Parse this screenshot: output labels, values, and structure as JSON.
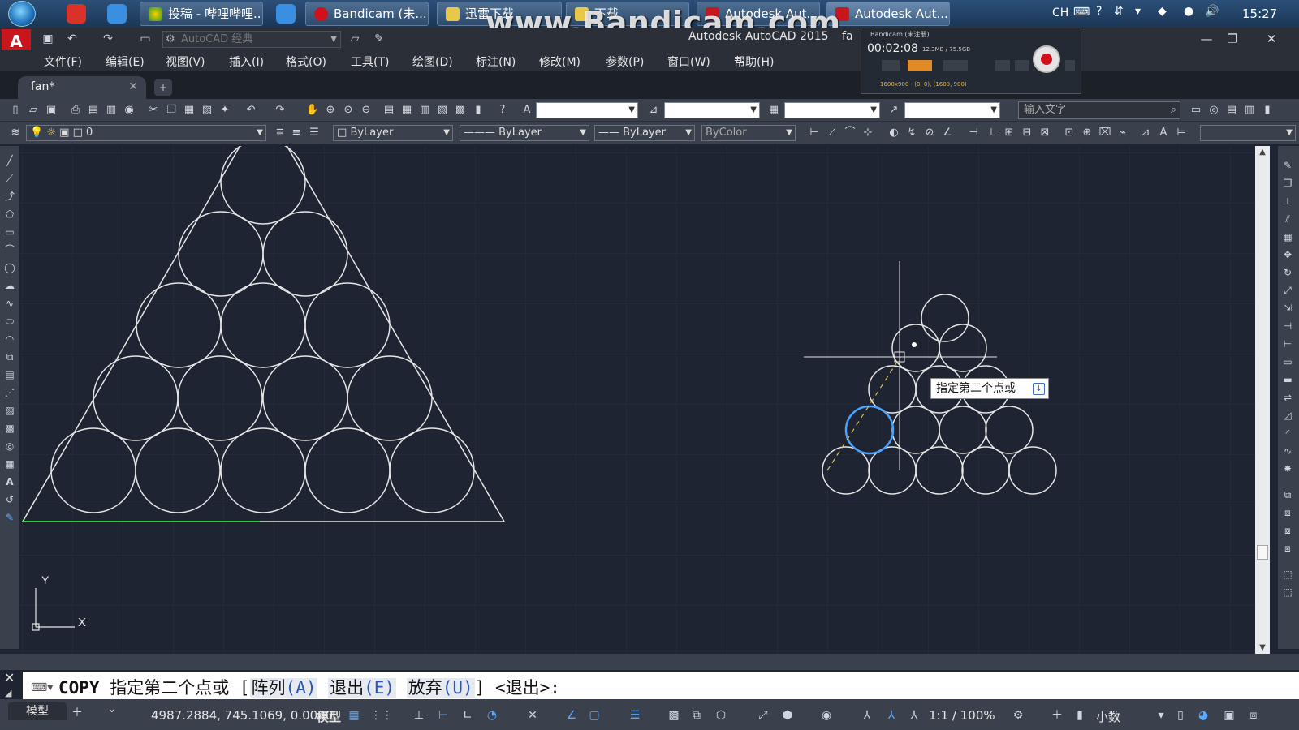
{
  "taskbar": {
    "tasks": [
      {
        "label": "投稿 - 哔哩哔哩...",
        "icon": "chrome-icon"
      },
      {
        "label": "Bandicam (未...",
        "icon": "bandicam-icon"
      },
      {
        "label": "迅雷下载",
        "icon": "folder-icon"
      },
      {
        "label": "下载",
        "icon": "folder-icon"
      },
      {
        "label": "Autodesk Aut...",
        "icon": "autocad-icon"
      },
      {
        "label": "Autodesk Aut...",
        "icon": "autocad-icon"
      }
    ],
    "tray_lang": "CH",
    "clock": "15:27"
  },
  "watermark": "www.Bandicam.com",
  "titlebar": {
    "workspace": "AutoCAD 经典",
    "app_title": "Autodesk AutoCAD 2015",
    "file_fragment": "fa"
  },
  "menu": [
    "文件(F)",
    "编辑(E)",
    "视图(V)",
    "插入(I)",
    "格式(O)",
    "工具(T)",
    "绘图(D)",
    "标注(N)",
    "修改(M)",
    "参数(P)",
    "窗口(W)",
    "帮助(H)"
  ],
  "file_tab": {
    "name": "fan*",
    "close": "✕",
    "new": "+"
  },
  "search": {
    "placeholder": "输入文字"
  },
  "properties": {
    "layer": "0",
    "color": "ByLayer",
    "linetype": "ByLayer",
    "lineweight": "ByLayer",
    "plotstyle": "ByColor"
  },
  "bandicam": {
    "title": "Bandicam (未注册)",
    "time": "00:02:08",
    "size": "12.3MB / 75.5GB",
    "resolution": "1600x900 - (0, 0), (1600, 900)"
  },
  "ucs": {
    "x": "X",
    "y": "Y"
  },
  "tooltip": {
    "text": "指定第二个点或"
  },
  "command": {
    "name": "COPY",
    "prompt": "指定第二个点或",
    "open": "[",
    "opt1": "阵列",
    "opt1_key": "(A)",
    "opt2": "退出",
    "opt2_key": "(E)",
    "opt3": "放弃",
    "opt3_key": "(U)",
    "close": "]",
    "default": "<退出>:"
  },
  "status": {
    "model_tab": "模型",
    "coords": "4987.2884, 745.1069, 0.0000",
    "space": "模型",
    "scale": "1:1 / 100%",
    "units": "小数"
  },
  "colors": {
    "canvas": "#1e2431",
    "circle": "#e8e8e8",
    "highlight": "#4aa3ff",
    "baseline": "#2ecc40",
    "dash": "#d4c24a"
  }
}
